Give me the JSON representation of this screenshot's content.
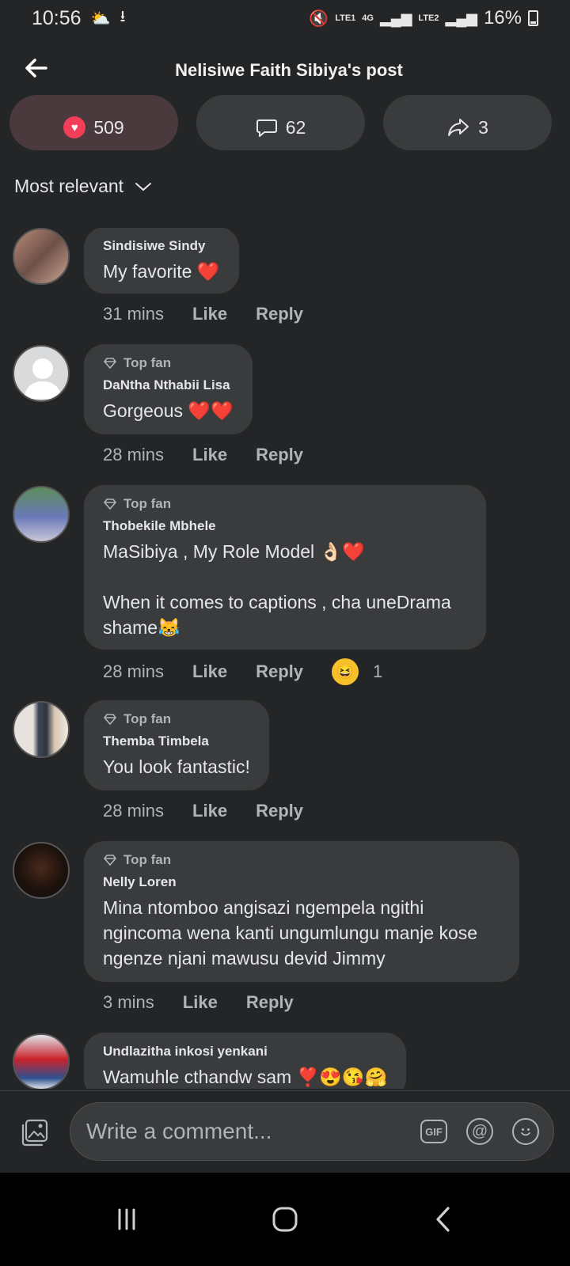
{
  "status": {
    "time": "10:56",
    "net1": "LTE1",
    "net2": "4G",
    "net3": "LTE2",
    "battery": "16%"
  },
  "header": {
    "title": "Nelisiwe Faith Sibiya's post"
  },
  "reactions": {
    "love_count": "509",
    "comment_count": "62",
    "share_count": "3"
  },
  "sort": {
    "label": "Most relevant"
  },
  "comments": [
    {
      "top_fan": "",
      "author": "Sindisiwe Sindy",
      "text": "My favorite ❤️",
      "time": "31 mins",
      "like": "Like",
      "reply": "Reply"
    },
    {
      "top_fan": "Top fan",
      "author": "DaNtha Nthabii Lisa",
      "text": "Gorgeous ❤️❤️",
      "time": "28 mins",
      "like": "Like",
      "reply": "Reply"
    },
    {
      "top_fan": "Top fan",
      "author": "Thobekile Mbhele",
      "text_line1": "MaSibiya , My Role Model 👌🏻❤️",
      "text_line2": "When it comes to captions , cha uneDrama shame😹",
      "time": "28 mins",
      "like": "Like",
      "reply": "Reply",
      "reaction_count": "1"
    },
    {
      "top_fan": "Top fan",
      "author": "Themba Timbela",
      "text": "You look fantastic!",
      "time": "28 mins",
      "like": "Like",
      "reply": "Reply"
    },
    {
      "top_fan": "Top fan",
      "author": "Nelly Loren",
      "text": "Mina ntomboo  angisazi ngempela  ngithi ngincoma wena kanti ungumlungu  manje kose ngenze njani  mawusu devid Jimmy",
      "time": "3 mins",
      "like": "Like",
      "reply": "Reply"
    },
    {
      "top_fan": "",
      "author": "Undlazitha inkosi yenkani",
      "text": "Wamuhle cthandw sam ❣️😍😘🤗"
    }
  ],
  "composer": {
    "placeholder": "Write a comment...",
    "gif_label": "GIF",
    "mention_label": "@"
  },
  "colors": {
    "background": "#242526",
    "bubble": "#3a3b3c",
    "love": "#f33e58",
    "text": "#e4e6eb",
    "muted": "#b0b3b8"
  }
}
